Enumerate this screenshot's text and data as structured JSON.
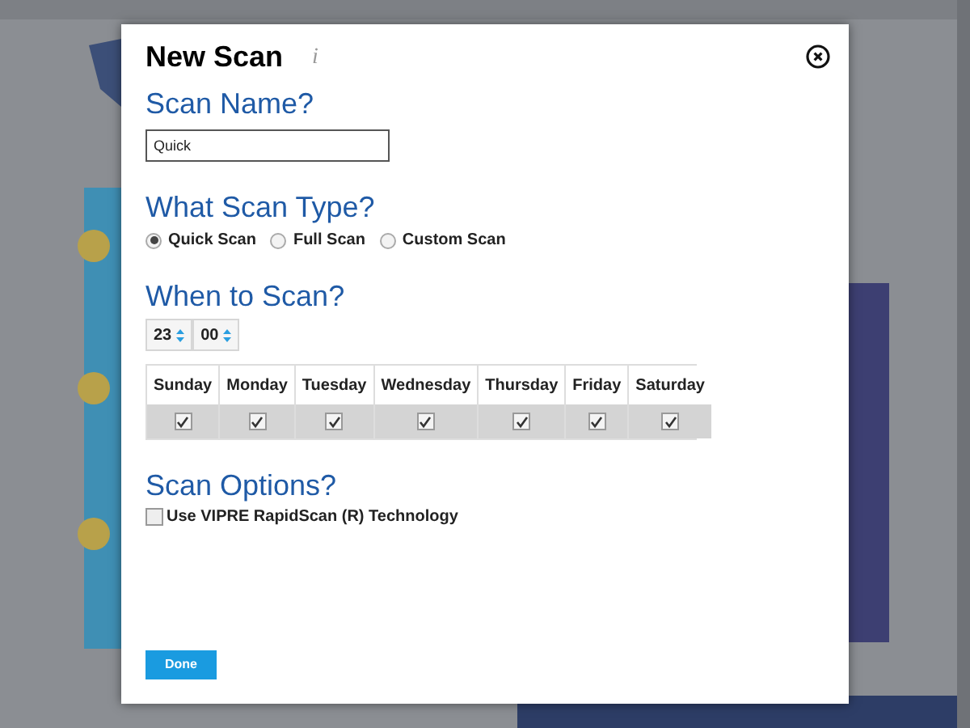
{
  "dialog": {
    "title": "New Scan",
    "info_glyph": "i"
  },
  "scan_name": {
    "heading": "Scan Name?",
    "value": "Quick"
  },
  "scan_type": {
    "heading": "What Scan Type?",
    "options": [
      {
        "label": "Quick Scan",
        "selected": true
      },
      {
        "label": "Full Scan",
        "selected": false
      },
      {
        "label": "Custom Scan",
        "selected": false
      }
    ]
  },
  "when": {
    "heading": "When to Scan?",
    "hour": "23",
    "minute": "00",
    "days": [
      {
        "label": "Sunday",
        "checked": true
      },
      {
        "label": "Monday",
        "checked": true
      },
      {
        "label": "Tuesday",
        "checked": true
      },
      {
        "label": "Wednesday",
        "checked": true
      },
      {
        "label": "Thursday",
        "checked": true
      },
      {
        "label": "Friday",
        "checked": true
      },
      {
        "label": "Saturday",
        "checked": true
      }
    ]
  },
  "options": {
    "heading": "Scan Options?",
    "items": [
      {
        "label": "Use VIPRE RapidScan (R) Technology",
        "checked": false
      }
    ]
  },
  "done_button": "Done"
}
